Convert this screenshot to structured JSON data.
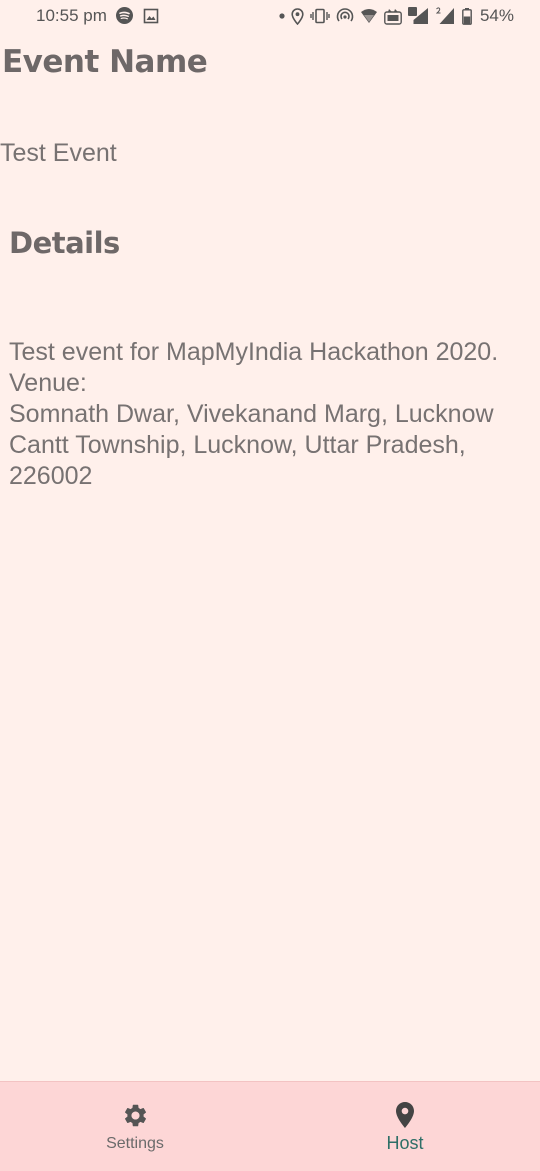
{
  "status_bar": {
    "time": "10:55 pm",
    "battery_percent": "54%",
    "icons_left": [
      "spotify-icon",
      "image-icon"
    ],
    "icons_right": [
      "dot-icon",
      "location-icon",
      "vibrate-icon",
      "hotspot-icon",
      "wifi-icon",
      "volte-icon",
      "signal-sim1-icon",
      "signal-sim2-icon",
      "battery-icon"
    ]
  },
  "event": {
    "name_label": "Event Name",
    "name_value": "Test Event",
    "details_label": "Details",
    "details_lines": [
      "Test event for MapMyIndia Hackathon 2020.",
      "Venue:",
      "Somnath Dwar, Vivekanand Marg, Lucknow",
      "Cantt Township, Lucknow, Uttar Pradesh,",
      "226002"
    ]
  },
  "bottom_nav": {
    "items": [
      {
        "label": "Settings",
        "icon": "gear-icon",
        "active": false
      },
      {
        "label": "Host",
        "icon": "location-pin-icon",
        "active": true
      }
    ]
  },
  "colors": {
    "background": "#fff0eb",
    "nav_background": "#fdd6d6",
    "text": "#777272",
    "active_nav": "#2e6f67"
  }
}
